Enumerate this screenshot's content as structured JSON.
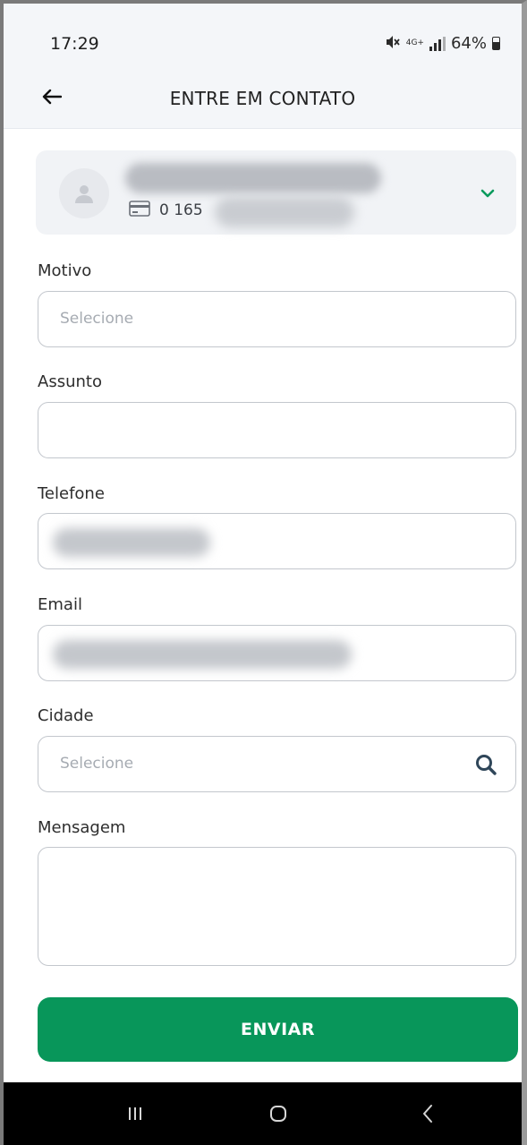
{
  "status": {
    "time": "17:29",
    "network": "4G+",
    "battery": "64%"
  },
  "header": {
    "title": "ENTRE EM CONTATO"
  },
  "account": {
    "card_number_prefix": "0 165"
  },
  "form": {
    "motivo": {
      "label": "Motivo",
      "placeholder": "Selecione"
    },
    "assunto": {
      "label": "Assunto",
      "value": ""
    },
    "telefone": {
      "label": "Telefone"
    },
    "email": {
      "label": "Email"
    },
    "cidade": {
      "label": "Cidade",
      "placeholder": "Selecione"
    },
    "mensagem": {
      "label": "Mensagem",
      "value": ""
    }
  },
  "actions": {
    "send_label": "ENVIAR"
  },
  "colors": {
    "primary": "#08965a",
    "chevron": "#0a9a5c",
    "search_icon": "#2f4659"
  },
  "icons": [
    "mute-icon",
    "signal-icon",
    "battery-icon",
    "back-arrow-icon",
    "avatar-icon",
    "card-icon",
    "chevron-down-icon",
    "search-icon",
    "recents-icon",
    "home-icon",
    "back-icon"
  ]
}
